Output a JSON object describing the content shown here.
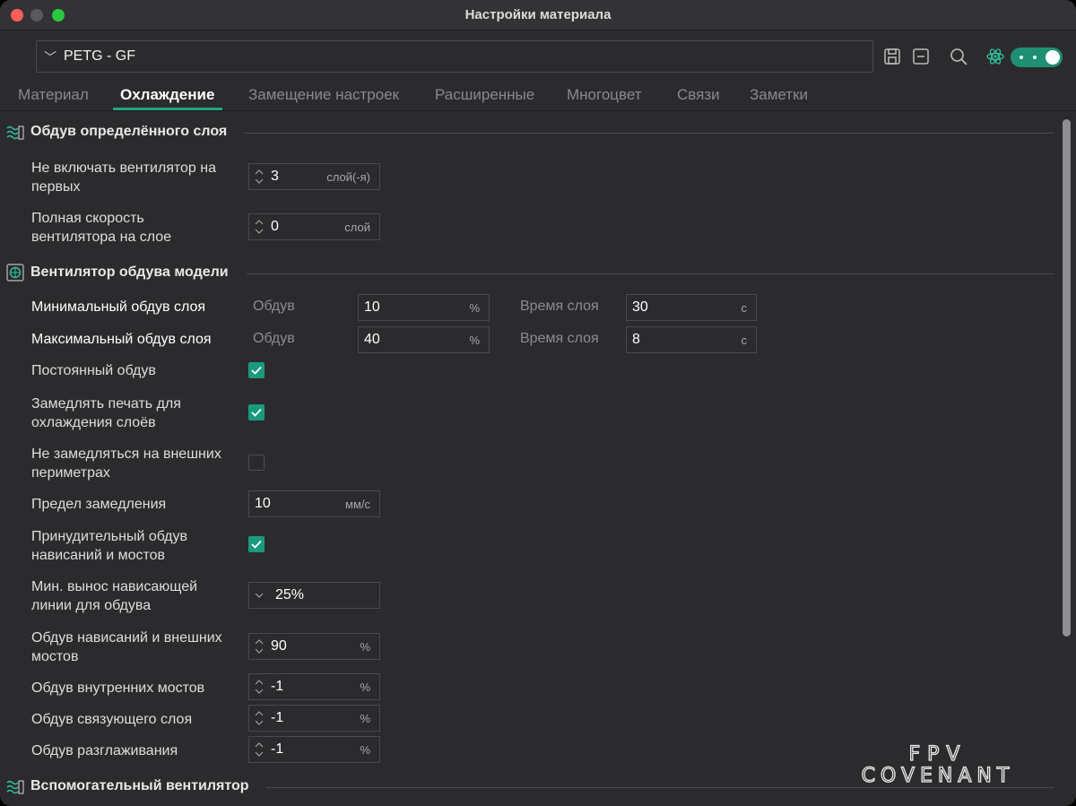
{
  "window": {
    "title": "Настройки материала"
  },
  "preset": {
    "value": "PETG - GF"
  },
  "toolbar": {
    "icons": [
      "save-icon",
      "remove-preset-icon",
      "search-icon",
      "atom-icon"
    ],
    "toggle_state": "on"
  },
  "tabs": [
    {
      "label": "Материал"
    },
    {
      "label": "Охлаждение",
      "active": true
    },
    {
      "label": "Замещение настроек"
    },
    {
      "label": "Расширенные"
    },
    {
      "label": "Многоцвет"
    },
    {
      "label": "Связи"
    },
    {
      "label": "Заметки"
    }
  ],
  "sections": {
    "layer_fan": {
      "title": "Обдув определённого слоя"
    },
    "part_fan": {
      "title": "Вентилятор обдува модели"
    },
    "aux_fan": {
      "title": "Вспомогательный вентилятор"
    }
  },
  "settings": {
    "no_fan_first": {
      "label1": "Не включать вентилятор на",
      "label2": "первых",
      "value": "3",
      "unit": "слой(-я)"
    },
    "full_speed_layer": {
      "label1": "Полная скорость",
      "label2": "вентилятора на слое",
      "value": "0",
      "unit": "слой"
    },
    "min_fan": {
      "label": "Минимальный обдув слоя",
      "fan_label": "Обдув",
      "fan_value": "10",
      "fan_unit": "%",
      "time_label": "Время слоя",
      "time_value": "30",
      "time_unit": "с"
    },
    "max_fan": {
      "label": "Максимальный обдув слоя",
      "fan_label": "Обдув",
      "fan_value": "40",
      "fan_unit": "%",
      "time_label": "Время слоя",
      "time_value": "8",
      "time_unit": "с"
    },
    "constant_fan": {
      "label": "Постоянный обдув",
      "checked": true
    },
    "slow_down": {
      "label1": "Замедлять печать для",
      "label2": "охлаждения слоёв",
      "checked": true
    },
    "dont_slow_outer": {
      "label1": "Не замедляться на внешних",
      "label2": "периметрах",
      "checked": false
    },
    "slow_limit": {
      "label": "Предел замедления",
      "value": "10",
      "unit": "мм/с"
    },
    "force_overhang": {
      "label1": "Принудительный обдув",
      "label2": "нависаний и мостов",
      "checked": true
    },
    "min_overhang": {
      "label1": "Мин. вынос нависающей",
      "label2": "линии для обдува",
      "value": "25%"
    },
    "overhang_fan": {
      "label1": "Обдув нависаний и внешних",
      "label2": "мостов",
      "value": "90",
      "unit": "%"
    },
    "internal_bridge_fan": {
      "label": "Обдув внутренних мостов",
      "value": "-1",
      "unit": "%"
    },
    "interface_fan": {
      "label": "Обдув связующего слоя",
      "value": "-1",
      "unit": "%"
    },
    "ironing_fan": {
      "label": "Обдув разглаживания",
      "value": "-1",
      "unit": "%"
    }
  },
  "watermark": {
    "line1": "FPV",
    "line2": "COVENANT"
  },
  "colors": {
    "accent": "#1a9a7d",
    "background": "#2b2b2e",
    "border": "#4a4a4e"
  }
}
